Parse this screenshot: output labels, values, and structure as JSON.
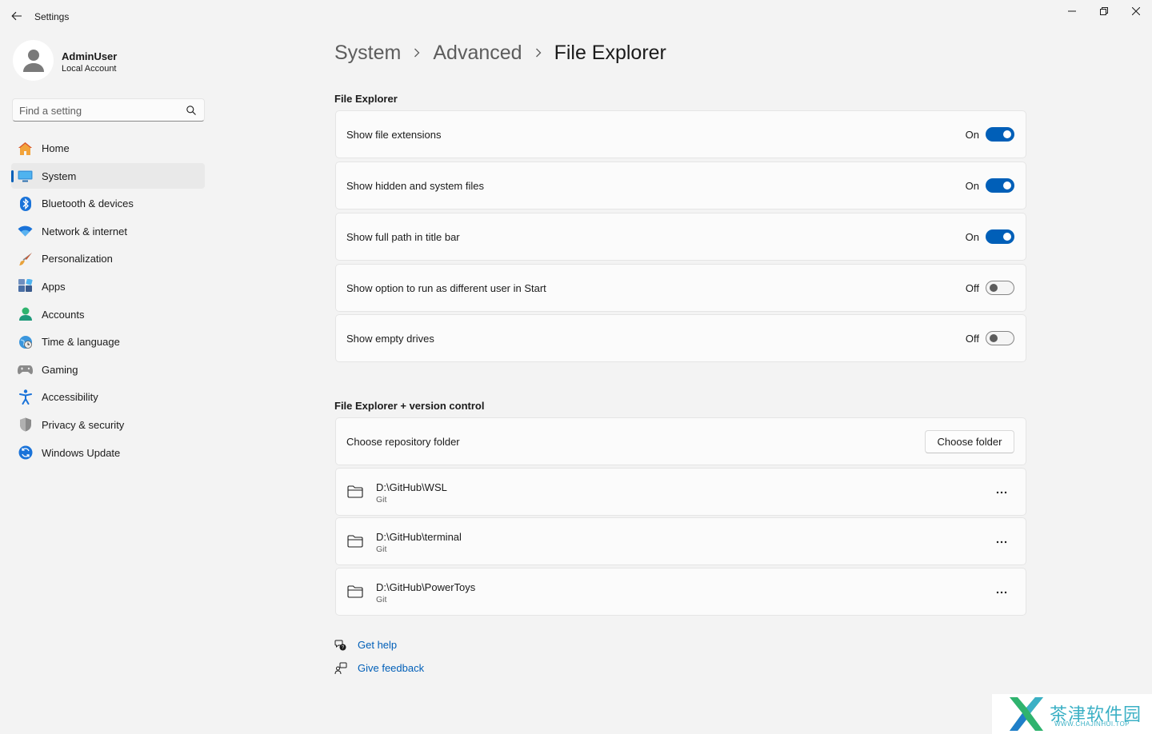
{
  "window": {
    "title": "Settings"
  },
  "user": {
    "name": "AdminUser",
    "account_type": "Local Account"
  },
  "search": {
    "placeholder": "Find a setting",
    "value": ""
  },
  "nav": {
    "items": [
      {
        "label": "Home",
        "icon": "home-icon",
        "active": false
      },
      {
        "label": "System",
        "icon": "system-icon",
        "active": true
      },
      {
        "label": "Bluetooth & devices",
        "icon": "bluetooth-icon",
        "active": false
      },
      {
        "label": "Network & internet",
        "icon": "wifi-icon",
        "active": false
      },
      {
        "label": "Personalization",
        "icon": "brush-icon",
        "active": false
      },
      {
        "label": "Apps",
        "icon": "apps-icon",
        "active": false
      },
      {
        "label": "Accounts",
        "icon": "accounts-icon",
        "active": false
      },
      {
        "label": "Time & language",
        "icon": "globe-clock-icon",
        "active": false
      },
      {
        "label": "Gaming",
        "icon": "gamepad-icon",
        "active": false
      },
      {
        "label": "Accessibility",
        "icon": "accessibility-icon",
        "active": false
      },
      {
        "label": "Privacy & security",
        "icon": "shield-icon",
        "active": false
      },
      {
        "label": "Windows Update",
        "icon": "update-icon",
        "active": false
      }
    ]
  },
  "breadcrumb": {
    "items": [
      "System",
      "Advanced",
      "File Explorer"
    ]
  },
  "file_explorer": {
    "title": "File Explorer",
    "settings": [
      {
        "label": "Show file extensions",
        "state": "On"
      },
      {
        "label": "Show hidden and system files",
        "state": "On"
      },
      {
        "label": "Show full path in title bar",
        "state": "On"
      },
      {
        "label": "Show option to run as different user in Start",
        "state": "Off"
      },
      {
        "label": "Show empty drives",
        "state": "Off"
      }
    ]
  },
  "version_control": {
    "title": "File Explorer + version control",
    "choose_label": "Choose repository folder",
    "choose_button": "Choose folder",
    "repos": [
      {
        "path": "D:\\GitHub\\WSL",
        "type": "Git"
      },
      {
        "path": "D:\\GitHub\\terminal",
        "type": "Git"
      },
      {
        "path": "D:\\GitHub\\PowerToys",
        "type": "Git"
      }
    ]
  },
  "links": {
    "help": "Get help",
    "feedback": "Give feedback"
  },
  "watermark": {
    "title": "茶津软件园",
    "url": "WWW.CHAJINHUI.TOP"
  },
  "colors": {
    "accent": "#005fb8",
    "background": "#f3f3f3",
    "card": "#fbfbfb"
  }
}
